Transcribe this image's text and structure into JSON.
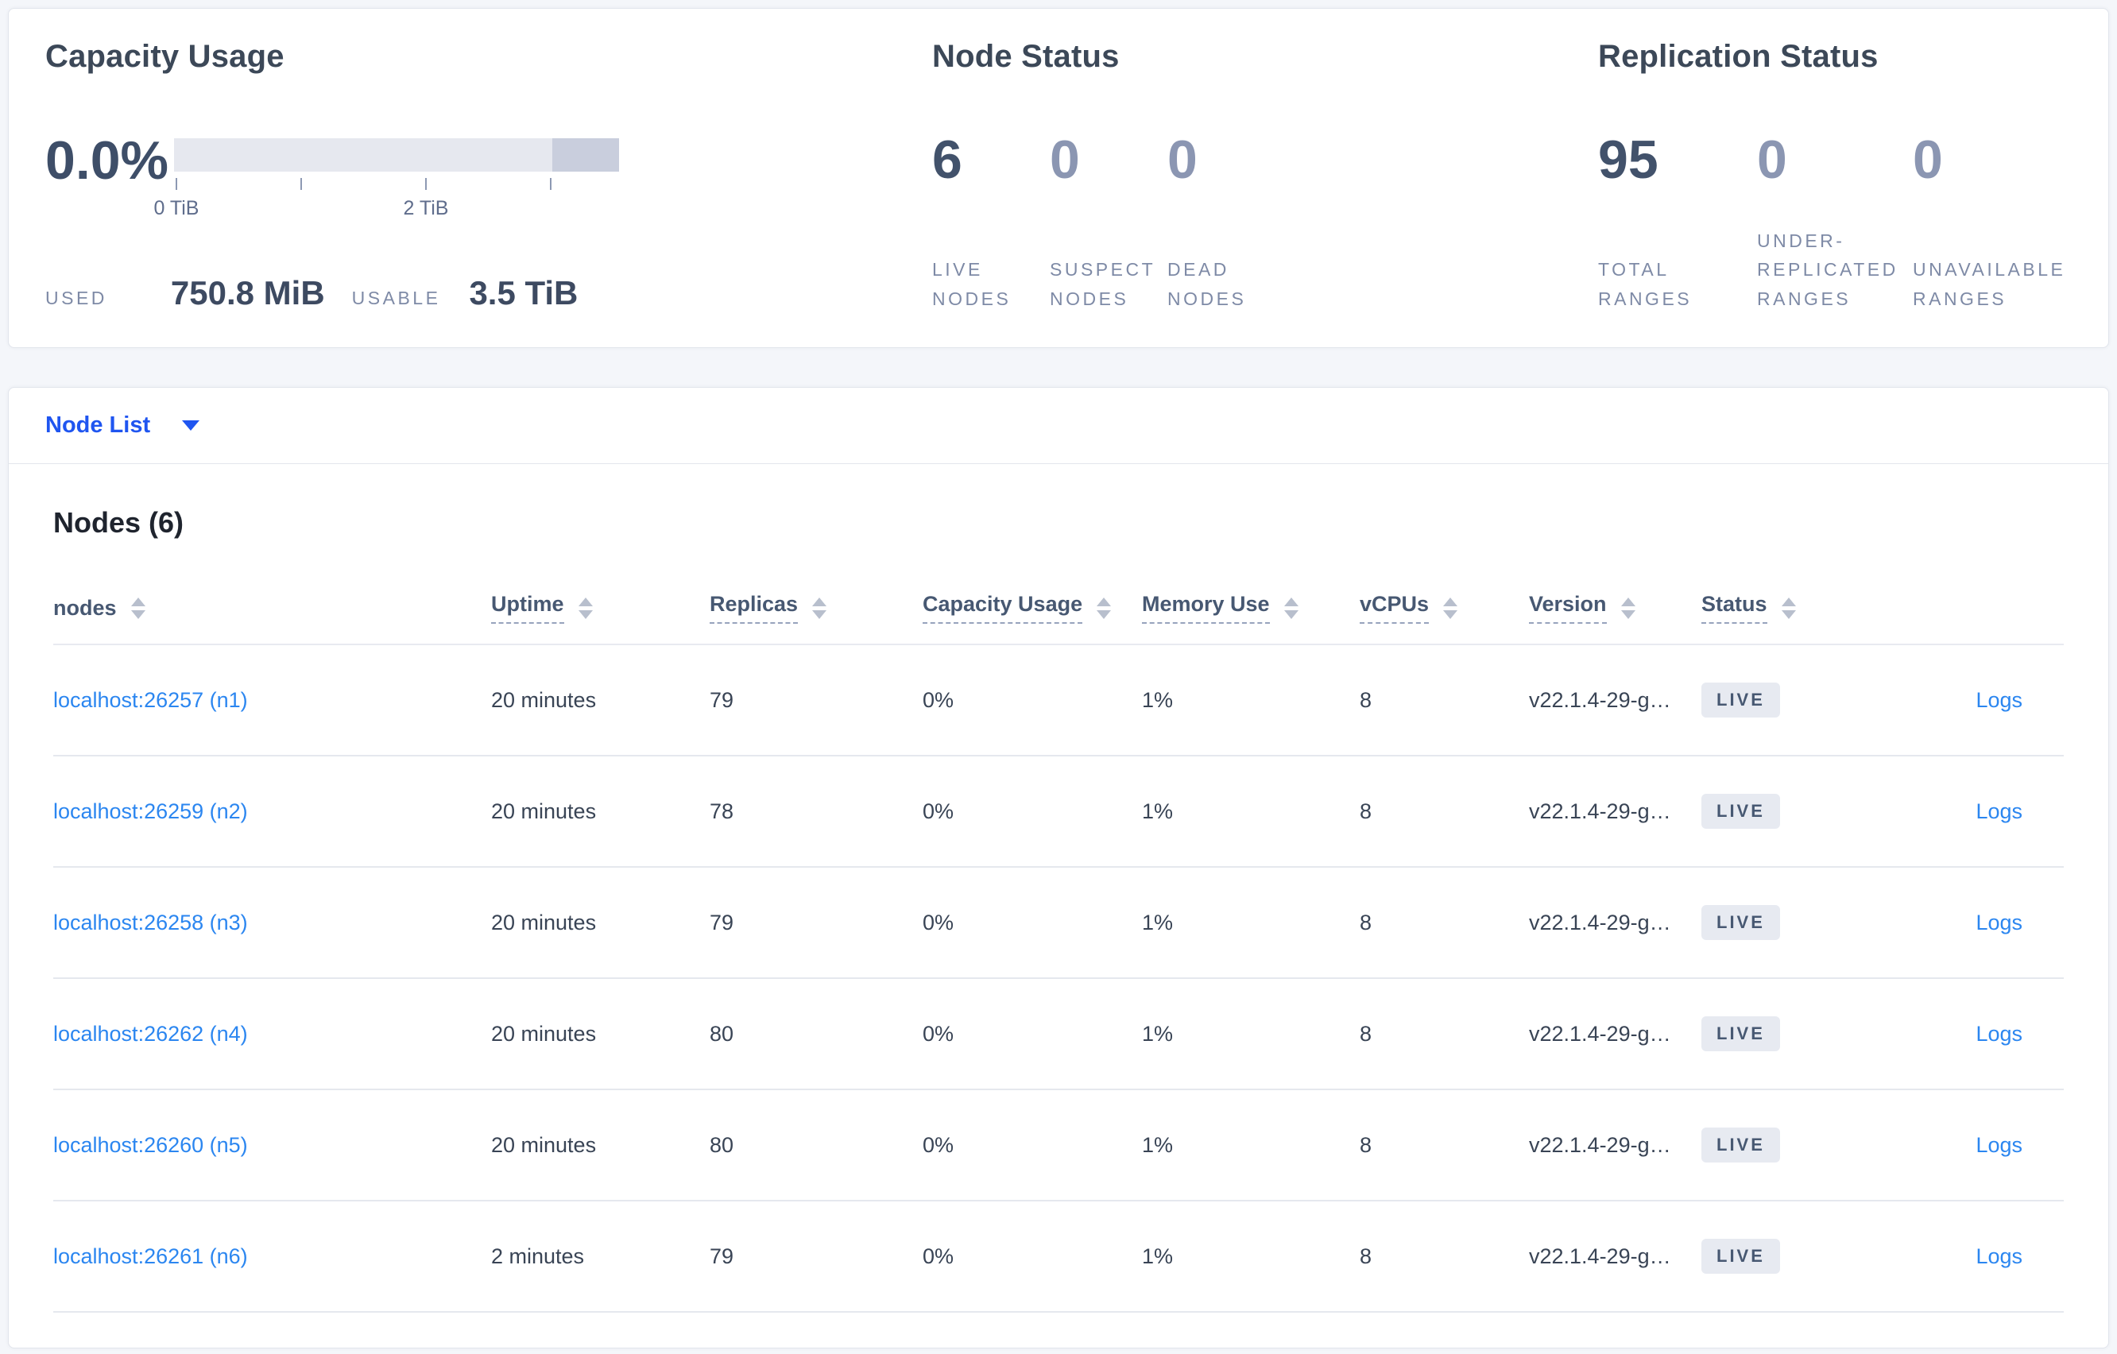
{
  "summary": {
    "capacity": {
      "title": "Capacity Usage",
      "percent": "0.0%",
      "used_label": "USED",
      "used_value": "750.8 MiB",
      "usable_label": "USABLE",
      "usable_value": "3.5 TiB",
      "axis_tick_0": "0 TiB",
      "axis_tick_2": "2 TiB",
      "bar": {
        "used_fraction": 0.0,
        "other_fraction": 0.15,
        "total_tib": 3.5
      }
    },
    "node_status": {
      "title": "Node Status",
      "metrics": [
        {
          "value": "6",
          "label": "LIVE\nNODES"
        },
        {
          "value": "0",
          "label": "SUSPECT\nNODES"
        },
        {
          "value": "0",
          "label": "DEAD\nNODES"
        }
      ]
    },
    "replication": {
      "title": "Replication Status",
      "metrics": [
        {
          "value": "95",
          "label": "TOTAL\nRANGES"
        },
        {
          "value": "0",
          "label": "UNDER-\nREPLICATED\nRANGES"
        },
        {
          "value": "0",
          "label": "UNAVAILABLE\nRANGES"
        }
      ]
    }
  },
  "node_list": {
    "dropdown_label": "Node List",
    "heading": "Nodes (6)",
    "columns": [
      "nodes",
      "Uptime",
      "Replicas",
      "Capacity Usage",
      "Memory Use",
      "vCPUs",
      "Version",
      "Status"
    ],
    "rows": [
      {
        "node": "localhost:26257 (n1)",
        "uptime": "20 minutes",
        "replicas": "79",
        "capacity": "0%",
        "memory": "1%",
        "vcpus": "8",
        "version": "v22.1.4-29-g…",
        "status": "LIVE",
        "logs": "Logs"
      },
      {
        "node": "localhost:26259 (n2)",
        "uptime": "20 minutes",
        "replicas": "78",
        "capacity": "0%",
        "memory": "1%",
        "vcpus": "8",
        "version": "v22.1.4-29-g…",
        "status": "LIVE",
        "logs": "Logs"
      },
      {
        "node": "localhost:26258 (n3)",
        "uptime": "20 minutes",
        "replicas": "79",
        "capacity": "0%",
        "memory": "1%",
        "vcpus": "8",
        "version": "v22.1.4-29-g…",
        "status": "LIVE",
        "logs": "Logs"
      },
      {
        "node": "localhost:26262 (n4)",
        "uptime": "20 minutes",
        "replicas": "80",
        "capacity": "0%",
        "memory": "1%",
        "vcpus": "8",
        "version": "v22.1.4-29-g…",
        "status": "LIVE",
        "logs": "Logs"
      },
      {
        "node": "localhost:26260 (n5)",
        "uptime": "20 minutes",
        "replicas": "80",
        "capacity": "0%",
        "memory": "1%",
        "vcpus": "8",
        "version": "v22.1.4-29-g…",
        "status": "LIVE",
        "logs": "Logs"
      },
      {
        "node": "localhost:26261 (n6)",
        "uptime": "2 minutes",
        "replicas": "79",
        "capacity": "0%",
        "memory": "1%",
        "vcpus": "8",
        "version": "v22.1.4-29-g…",
        "status": "LIVE",
        "logs": "Logs"
      }
    ]
  },
  "colors": {
    "page_background": "#f4f6fa",
    "card_background": "#ffffff",
    "dropdown_blue": "#1f55f0",
    "link_blue": "#2b86f0",
    "dark_slate": "#394455",
    "metric_strong": "#42526b",
    "metric_dim": "#8b96b2",
    "caps_label": "#7e8aa6",
    "bar_light": "#e6e8ef",
    "bar_dark": "#c9cedd",
    "badge_background": "#e7eaf1",
    "badge_text": "#475872"
  }
}
